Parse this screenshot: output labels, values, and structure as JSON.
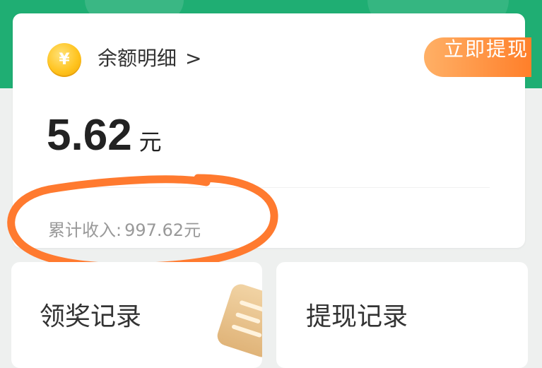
{
  "balance": {
    "coin_symbol": "¥",
    "detail_label": "余额明细",
    "detail_chevron": ">",
    "withdraw_label": "立即提现",
    "amount": "5.62",
    "unit": "元",
    "total_income_label": "累计收入:",
    "total_income_value": "997.62元"
  },
  "records": {
    "reward_label": "领奖记录",
    "withdraw_label": "提现记录"
  },
  "colors": {
    "header_green": "#1fae73",
    "withdraw_orange": "#ff7f2a",
    "annotation_orange": "#ff7a2f",
    "coin_gold": "#ffc420"
  },
  "icons": {
    "coin": "yuan-coin-icon",
    "clipboard": "clipboard-icon"
  }
}
